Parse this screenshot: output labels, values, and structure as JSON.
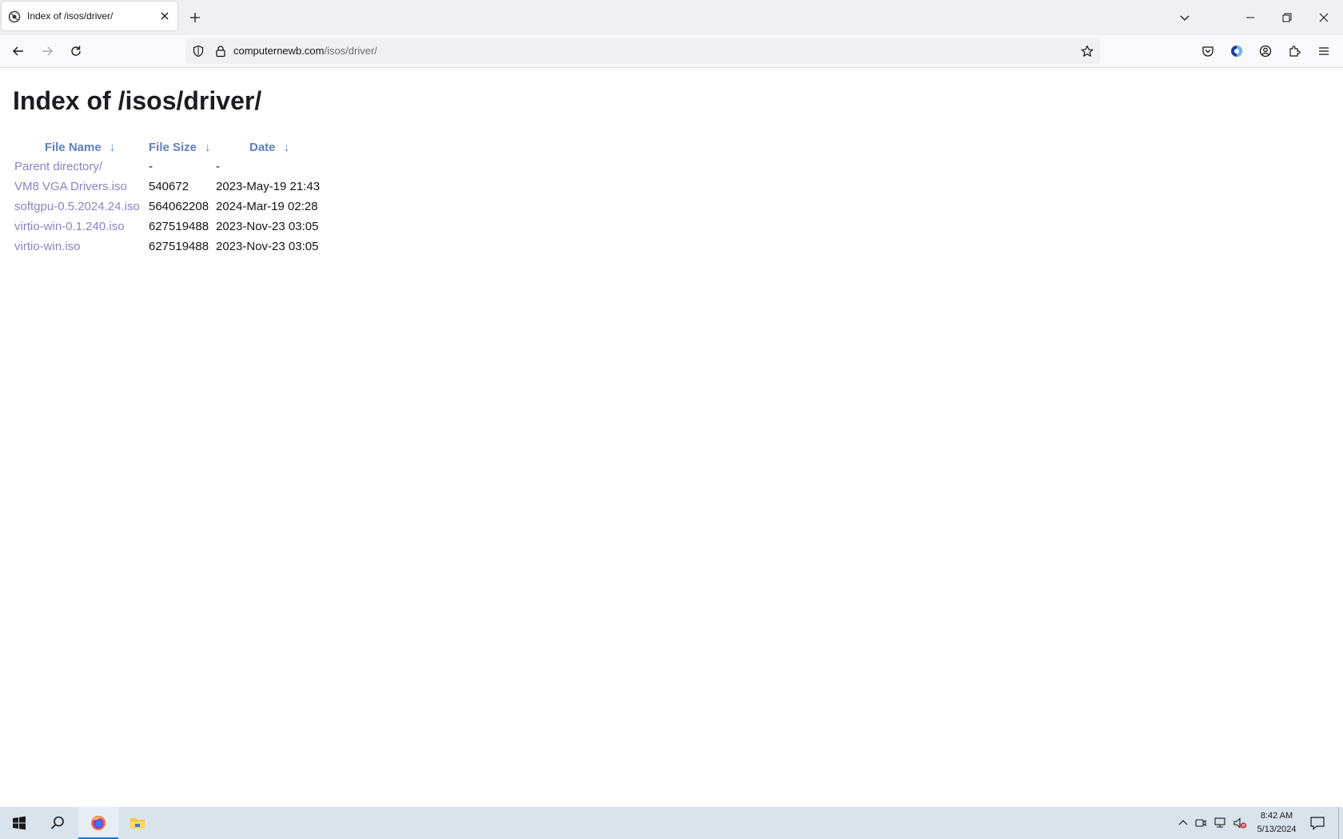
{
  "browser": {
    "tab": {
      "title": "Index of /isos/driver/"
    },
    "address_bar": {
      "host": "computernewb.com",
      "path": "/isos/driver/"
    }
  },
  "page": {
    "heading": "Index of /isos/driver/",
    "table": {
      "headers": [
        {
          "label": "File Name",
          "arrow": "↓"
        },
        {
          "label": "File Size",
          "arrow": "↓"
        },
        {
          "label": "Date",
          "arrow": "↓"
        }
      ],
      "rows": [
        {
          "name": "Parent directory/",
          "size": "-",
          "date": "-"
        },
        {
          "name": "VM8 VGA Drivers.iso",
          "size": "540672",
          "date": "2023-May-19 21:43"
        },
        {
          "name": "softgpu-0.5.2024.24.iso",
          "size": "564062208",
          "date": "2024-Mar-19 02:28"
        },
        {
          "name": "virtio-win-0.1.240.iso",
          "size": "627519488",
          "date": "2023-Nov-23 03:05"
        },
        {
          "name": "virtio-win.iso",
          "size": "627519488",
          "date": "2023-Nov-23 03:05"
        }
      ]
    }
  },
  "taskbar": {
    "clock": {
      "time": "8:42 AM",
      "date": "5/13/2024"
    }
  },
  "colors": {
    "link_header": "#5d7fc1",
    "link_file": "#8c82c4",
    "taskbar": "#d8e3ec",
    "accent": "#0078d7"
  }
}
